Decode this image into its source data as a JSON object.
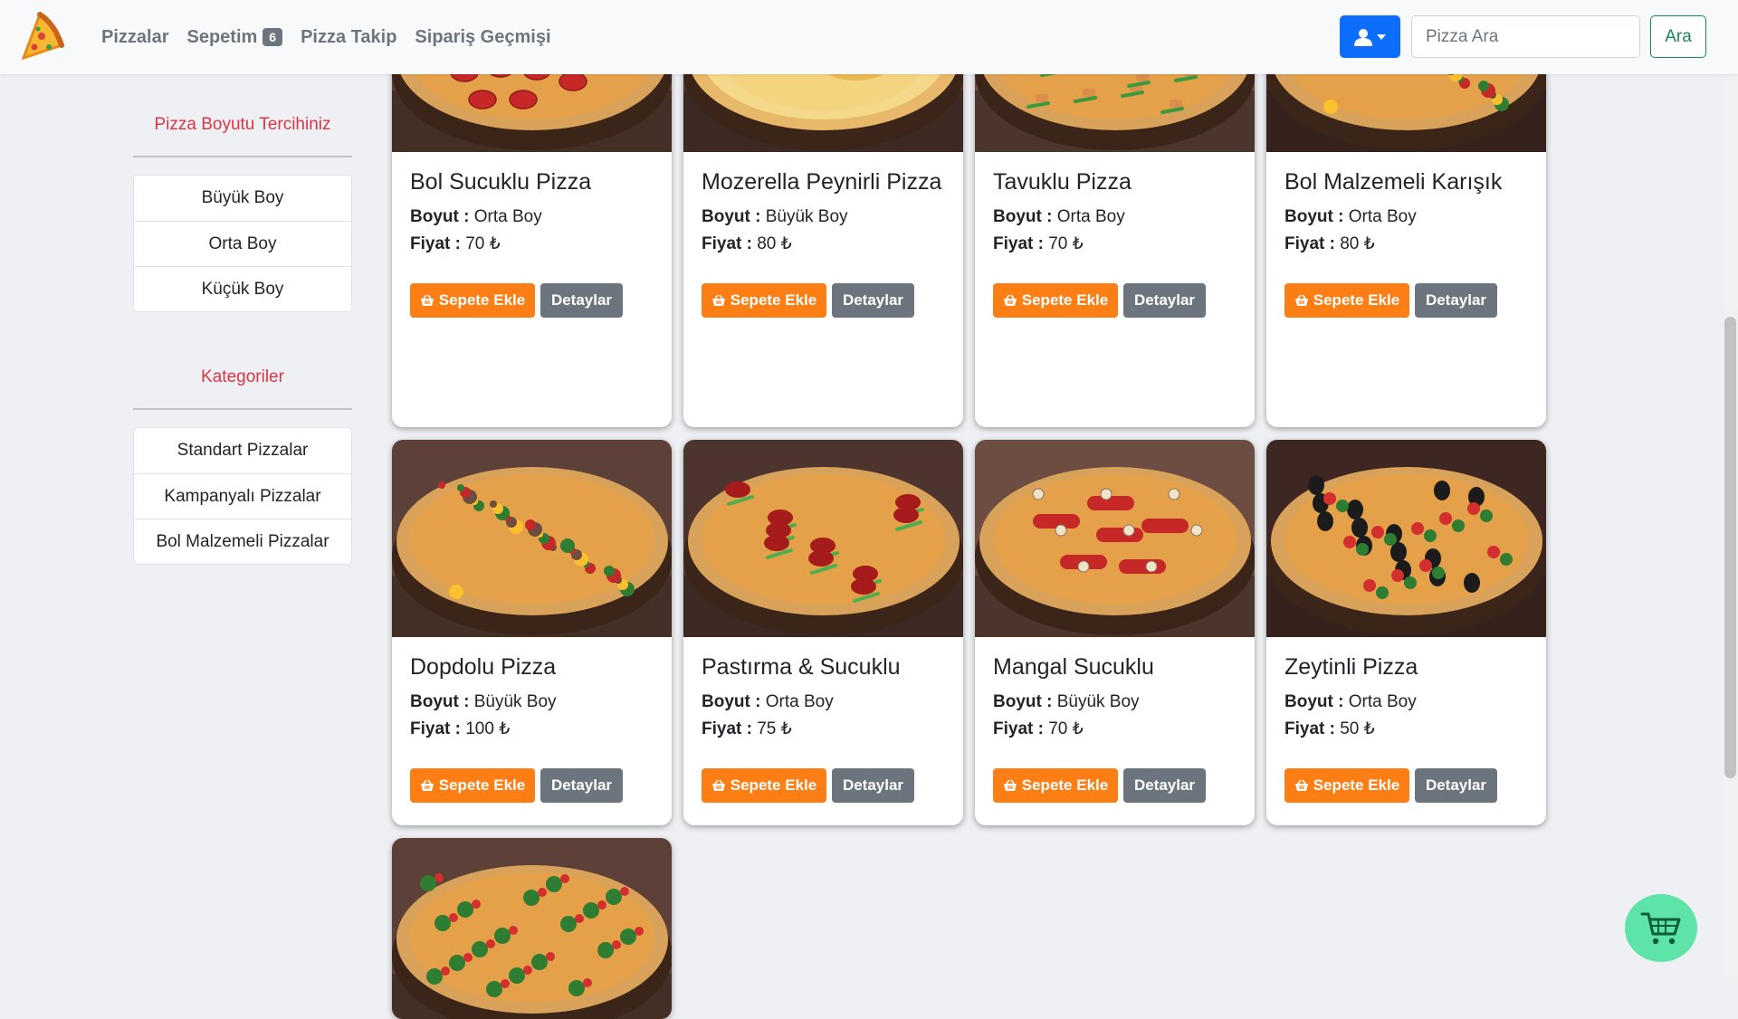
{
  "nav": {
    "items": [
      {
        "label": "Pizzalar"
      },
      {
        "label": "Sepetim",
        "badge": "6"
      },
      {
        "label": "Pizza Takip"
      },
      {
        "label": "Sipariş Geçmişi"
      }
    ],
    "search_placeholder": "Pizza Ara",
    "search_button": "Ara",
    "user_icon": "user-icon"
  },
  "sidebar": {
    "size_title": "Pizza Boyutu Tercihiniz",
    "sizes": [
      "Büyük Boy",
      "Orta Boy",
      "Küçük Boy"
    ],
    "category_title": "Kategoriler",
    "categories": [
      "Standart Pizzalar",
      "Kampanyalı Pizzalar",
      "Bol Malzemeli Pizzalar"
    ]
  },
  "card_labels": {
    "size_label": "Boyut :",
    "price_label": "Fiyat :",
    "add_button": "Sepete Ekle",
    "detail_button": "Detaylar",
    "currency": "₺"
  },
  "pizzas": [
    {
      "name": "Bol Sucuklu Pizza",
      "size": "Orta Boy",
      "price": "70 ₺",
      "topping": "pepperoni"
    },
    {
      "name": "Mozerella Peynirli Pizza",
      "size": "Büyük Boy",
      "price": "80 ₺",
      "topping": "cheese"
    },
    {
      "name": "Tavuklu Pizza",
      "size": "Orta Boy",
      "price": "70 ₺",
      "topping": "chicken"
    },
    {
      "name": "Bol Malzemeli Karışık",
      "size": "Orta Boy",
      "price": "80 ₺",
      "topping": "mixed"
    },
    {
      "name": "Dopdolu Pizza",
      "size": "Büyük Boy",
      "price": "100 ₺",
      "topping": "mixed"
    },
    {
      "name": "Pastırma & Sucuklu",
      "size": "Orta Boy",
      "price": "75 ₺",
      "topping": "pastrami"
    },
    {
      "name": "Mangal Sucuklu",
      "size": "Büyük Boy",
      "price": "70 ₺",
      "topping": "sausage"
    },
    {
      "name": "Zeytinli Pizza",
      "size": "Orta Boy",
      "price": "50 ₺",
      "topping": "olive"
    },
    {
      "name": "",
      "size": "",
      "price": "",
      "topping": "veggie"
    }
  ],
  "colors": {
    "accent_orange": "#fd7e14",
    "secondary_gray": "#6c757d",
    "primary_blue": "#0d6efd",
    "success_green": "#198754",
    "danger_red": "#dc3545",
    "cart_mint": "#5ee3a8"
  },
  "floating_cart": {
    "icon": "cart-icon"
  }
}
